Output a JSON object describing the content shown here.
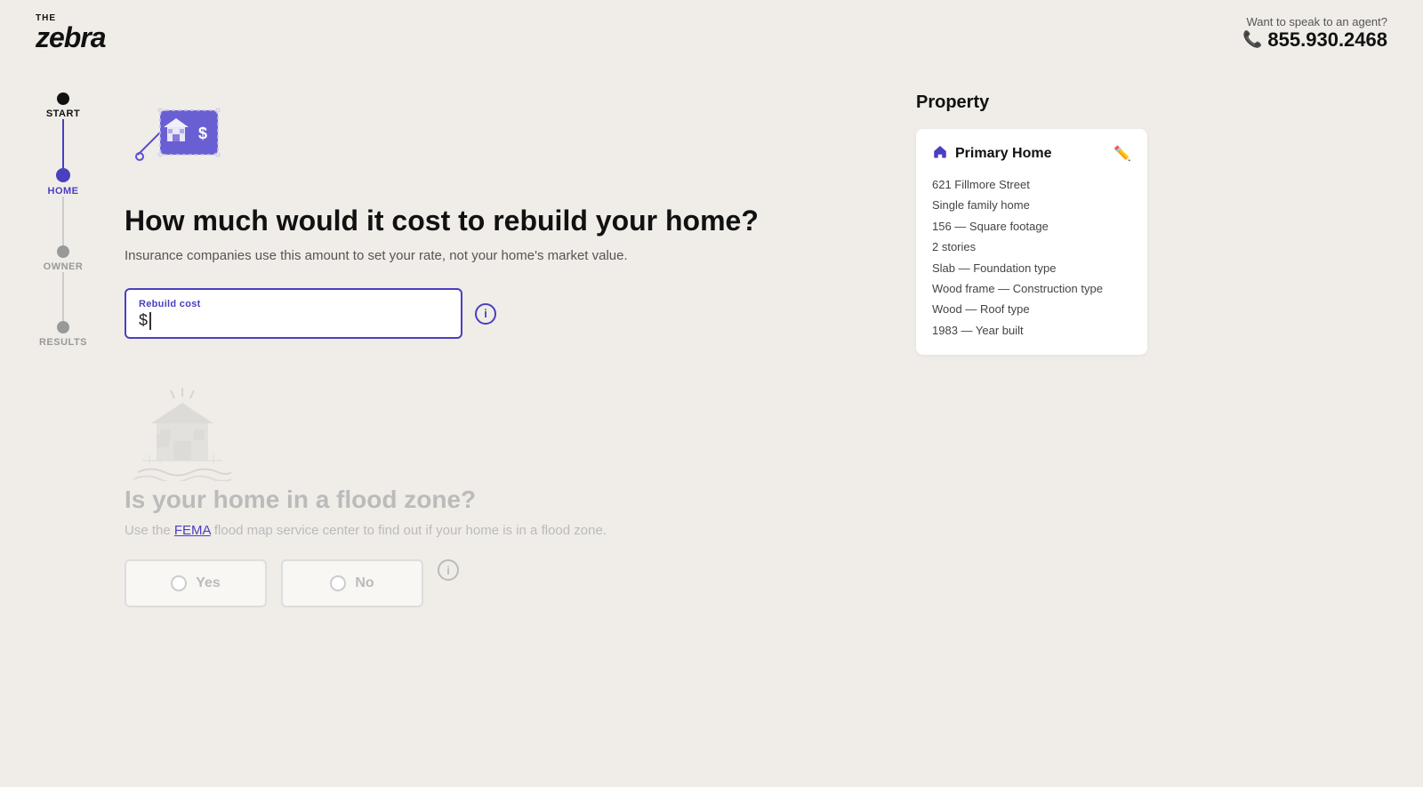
{
  "header": {
    "logo_the": "THE",
    "logo_zebra": "zebra",
    "contact_label": "Want to speak to an agent?",
    "phone": "855.930.2468"
  },
  "stepper": {
    "steps": [
      {
        "id": "start",
        "label": "START",
        "state": "completed"
      },
      {
        "id": "home",
        "label": "HOME",
        "state": "active"
      },
      {
        "id": "owner",
        "label": "OWNER",
        "state": "inactive"
      },
      {
        "id": "results",
        "label": "RESULTS",
        "state": "inactive"
      }
    ]
  },
  "rebuild_section": {
    "title": "How much would it cost to rebuild your home?",
    "subtitle": "Insurance companies use this amount to set your rate, not your home's market value.",
    "input_label": "Rebuild cost",
    "input_prefix": "$",
    "info_tooltip": "i"
  },
  "flood_section": {
    "title": "Is your home in a flood zone?",
    "subtitle_prefix": "Use the ",
    "fema_link": "FEMA",
    "subtitle_suffix": " flood map service center to find out if your home is in a flood zone.",
    "options": [
      {
        "label": "Yes"
      },
      {
        "label": "No"
      }
    ],
    "info_tooltip": "i"
  },
  "property": {
    "panel_title": "Property",
    "card_name": "Primary Home",
    "address": "621 Fillmore Street",
    "home_type": "Single family home",
    "square_footage": "156 — Square footage",
    "stories": "2 stories",
    "foundation": "Slab — Foundation type",
    "construction": "Wood frame — Construction type",
    "roof": "Wood — Roof type",
    "year_built": "1983 — Year built"
  },
  "colors": {
    "accent": "#4a3fc0",
    "background": "#f0ede8",
    "text_primary": "#111",
    "text_muted": "#999",
    "text_faded": "#bbb"
  }
}
